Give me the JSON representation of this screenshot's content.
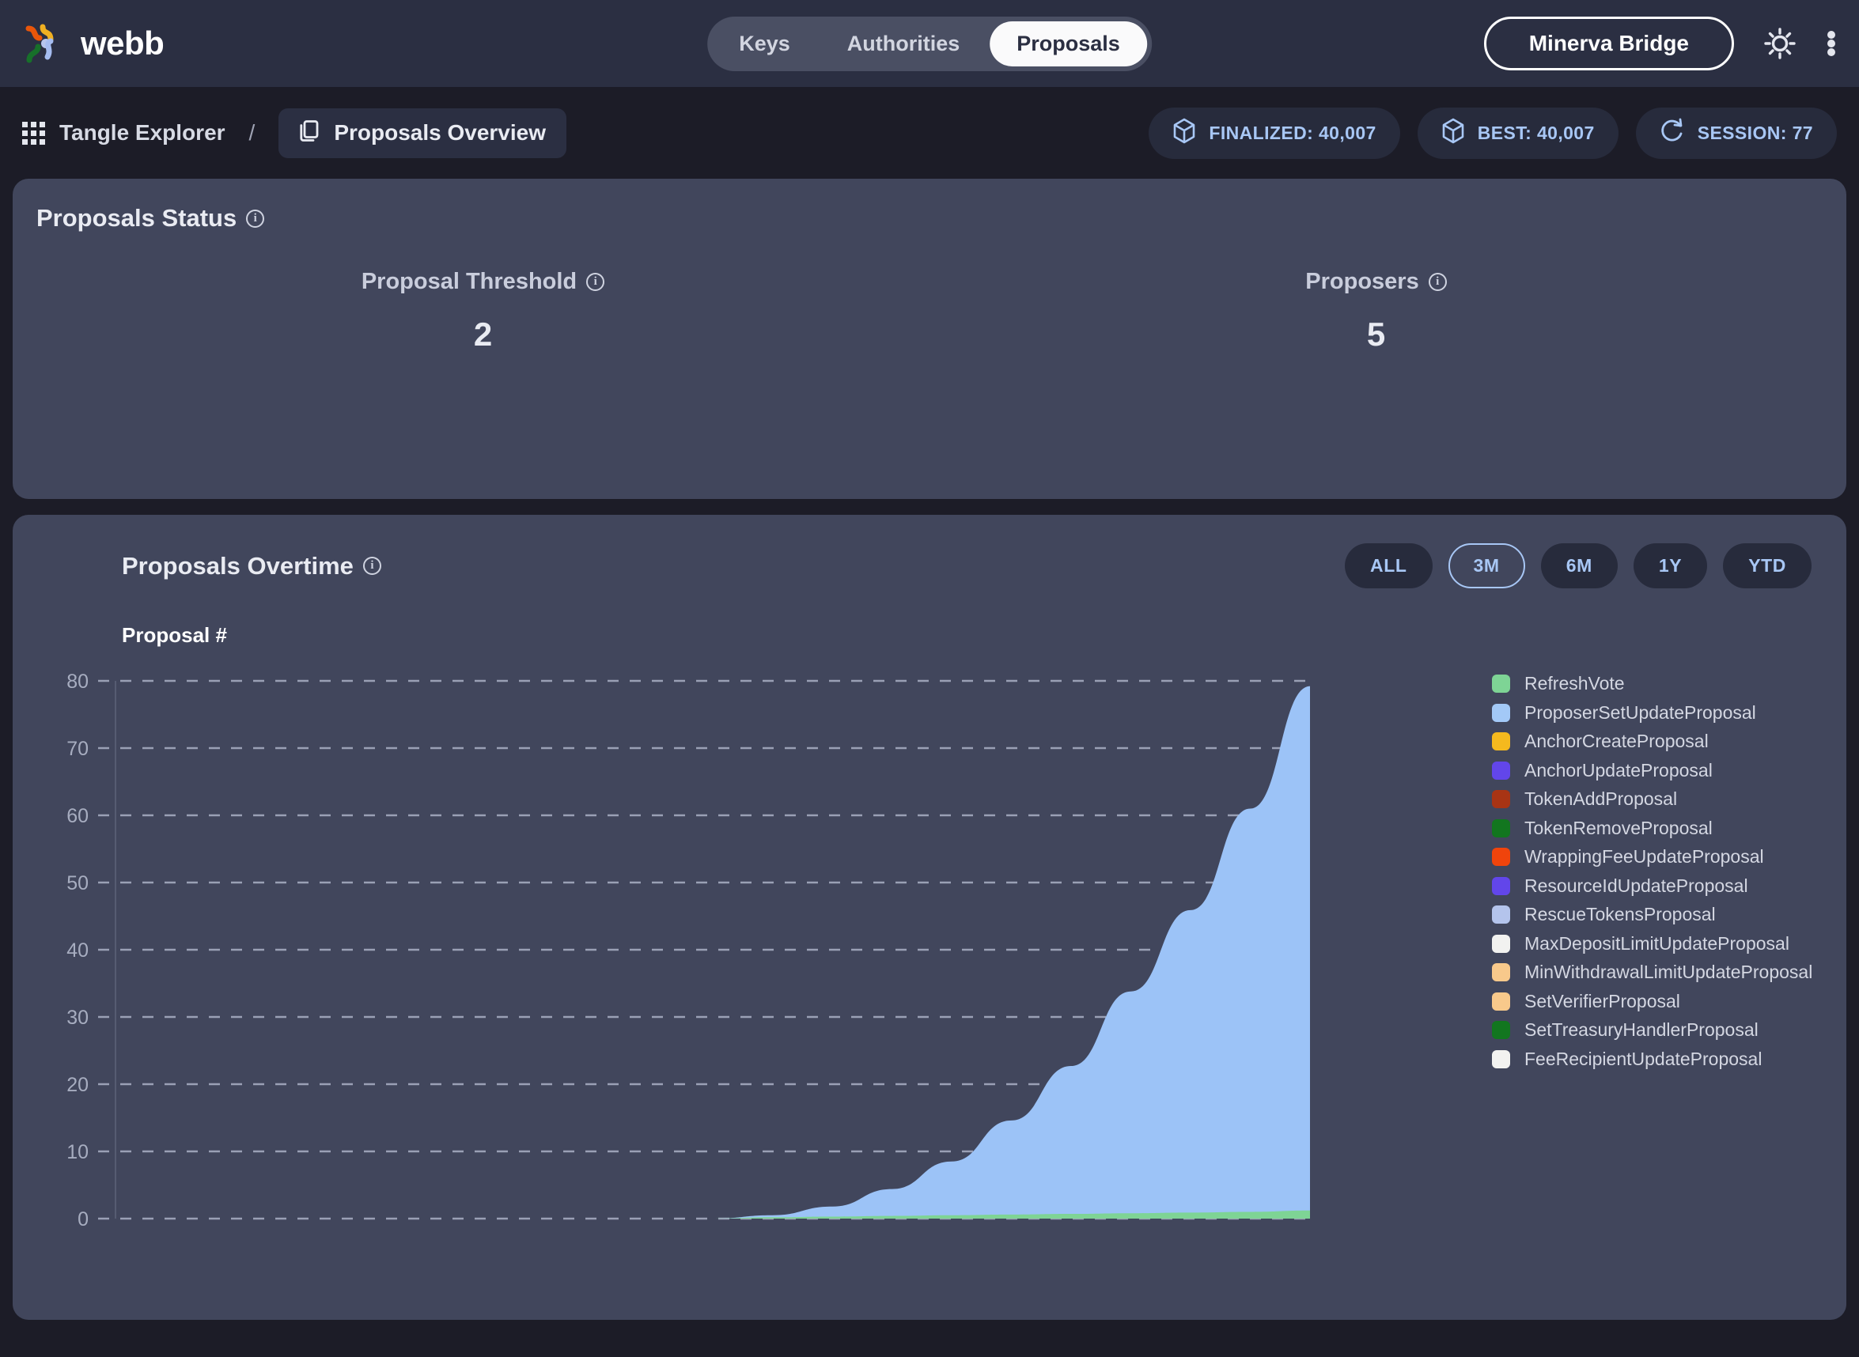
{
  "header": {
    "brand": "webb",
    "tabs": [
      {
        "label": "Keys",
        "active": false
      },
      {
        "label": "Authorities",
        "active": false
      },
      {
        "label": "Proposals",
        "active": true
      }
    ],
    "bridge_button": "Minerva Bridge",
    "theme_icon": "sun-icon",
    "menu_icon": "three-dot-menu-icon"
  },
  "breadcrumb": {
    "grid_icon": "apps-grid-icon",
    "root": "Tangle Explorer",
    "separator": "/",
    "current_icon": "copy-icon",
    "current": "Proposals Overview",
    "stats": [
      {
        "icon": "cube-icon",
        "label": "FINALIZED: 40,007"
      },
      {
        "icon": "cube-icon",
        "label": "BEST: 40,007"
      },
      {
        "icon": "refresh-icon",
        "label": "SESSION: 77"
      }
    ]
  },
  "status_card": {
    "title": "Proposals Status",
    "metrics": [
      {
        "label": "Proposal Threshold",
        "value": "2"
      },
      {
        "label": "Proposers",
        "value": "5"
      }
    ]
  },
  "overtime_card": {
    "title": "Proposals Overtime",
    "ranges": [
      {
        "label": "ALL",
        "active": false
      },
      {
        "label": "3M",
        "active": true
      },
      {
        "label": "6M",
        "active": false
      },
      {
        "label": "1Y",
        "active": false
      },
      {
        "label": "YTD",
        "active": false
      }
    ]
  },
  "colors": {
    "page_bg": "#1C1C27",
    "topbar_bg": "#2B2F42",
    "card_bg": "#41465C",
    "accent_blue": "#A8C7F5",
    "area_blue": "#9CC3F7",
    "area_green": "#7ED495"
  },
  "chart_data": {
    "type": "area",
    "title": "Proposals Overtime",
    "xlabel": "",
    "ylabel": "Proposal #",
    "ylim": [
      0,
      80
    ],
    "yticks": [
      0,
      10,
      20,
      30,
      40,
      50,
      60,
      70,
      80
    ],
    "grid": true,
    "legend_position": "right",
    "stacked": true,
    "x": [
      0,
      10,
      20,
      30,
      40,
      50,
      55,
      60,
      65,
      70,
      75,
      80,
      85,
      90,
      95,
      100
    ],
    "series": [
      {
        "name": "ProposerSetUpdateProposal",
        "color": "#9CC3F7",
        "values": [
          0,
          0,
          0,
          0,
          0,
          0,
          0.3,
          1.5,
          4,
          8,
          14,
          22,
          33,
          45,
          60,
          78
        ]
      },
      {
        "name": "RefreshVote",
        "color": "#7ED495",
        "values": [
          0,
          0,
          0,
          0,
          0,
          0,
          0.2,
          0.3,
          0.4,
          0.5,
          0.6,
          0.7,
          0.8,
          0.9,
          1.0,
          1.2
        ]
      }
    ],
    "legend": [
      {
        "name": "RefreshVote",
        "color": "#7ED495"
      },
      {
        "name": "ProposerSetUpdateProposal",
        "color": "#A3C9F7"
      },
      {
        "name": "AnchorCreateProposal",
        "color": "#F5B91E"
      },
      {
        "name": "AnchorUpdateProposal",
        "color": "#6246EA"
      },
      {
        "name": "TokenAddProposal",
        "color": "#A83414"
      },
      {
        "name": "TokenRemoveProposal",
        "color": "#12761F"
      },
      {
        "name": "WrappingFeeUpdateProposal",
        "color": "#F0440C"
      },
      {
        "name": "ResourceIdUpdateProposal",
        "color": "#6246EA"
      },
      {
        "name": "RescueTokensProposal",
        "color": "#B4C4EC"
      },
      {
        "name": "MaxDepositLimitUpdateProposal",
        "color": "#F2F2F0"
      },
      {
        "name": "MinWithdrawalLimitUpdateProposal",
        "color": "#F8C98B"
      },
      {
        "name": "SetVerifierProposal",
        "color": "#F8C98B"
      },
      {
        "name": "SetTreasuryHandlerProposal",
        "color": "#12761F"
      },
      {
        "name": "FeeRecipientUpdateProposal",
        "color": "#F2F2F0"
      }
    ]
  }
}
